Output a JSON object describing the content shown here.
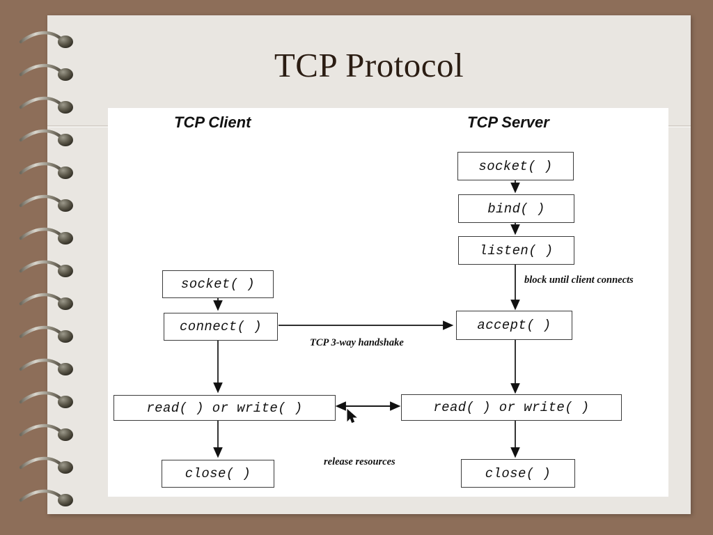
{
  "slide": {
    "title": "TCP Protocol",
    "background_color": "#8d6e59",
    "page_color": "#e9e6e1",
    "canvas_color": "#ffffff",
    "title_color": "#2b1d13"
  },
  "diagram": {
    "type": "flowchart",
    "columns": [
      {
        "id": "client",
        "header": "TCP Client"
      },
      {
        "id": "server",
        "header": "TCP Server"
      }
    ],
    "nodes": [
      {
        "id": "server-socket",
        "column": "server",
        "label": "socket( )"
      },
      {
        "id": "server-bind",
        "column": "server",
        "label": "bind( )"
      },
      {
        "id": "server-listen",
        "column": "server",
        "label": "listen( )"
      },
      {
        "id": "server-accept",
        "column": "server",
        "label": "accept( )"
      },
      {
        "id": "server-rw",
        "column": "server",
        "label": "read( ) or write( )"
      },
      {
        "id": "server-close",
        "column": "server",
        "label": "close( )"
      },
      {
        "id": "client-socket",
        "column": "client",
        "label": "socket( )"
      },
      {
        "id": "client-connect",
        "column": "client",
        "label": "connect( )"
      },
      {
        "id": "client-rw",
        "column": "client",
        "label": "read( ) or write( )"
      },
      {
        "id": "client-close",
        "column": "client",
        "label": "close( )"
      }
    ],
    "annotations": [
      {
        "id": "block-until",
        "text": "block until client connects"
      },
      {
        "id": "handshake",
        "text": "TCP 3-way handshake"
      },
      {
        "id": "release",
        "text": "release resources"
      }
    ]
  },
  "cursor": {
    "icon": "mouse-pointer"
  }
}
